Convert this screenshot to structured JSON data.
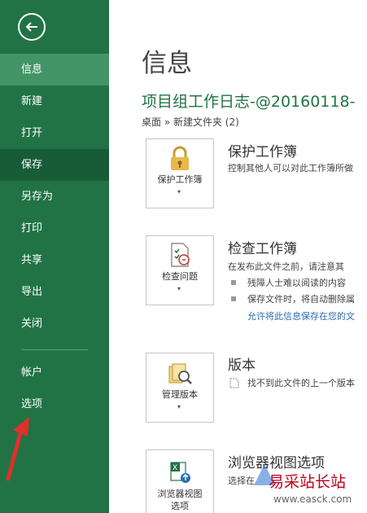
{
  "sidebar": {
    "items": [
      {
        "label": "信息"
      },
      {
        "label": "新建"
      },
      {
        "label": "打开"
      },
      {
        "label": "保存"
      },
      {
        "label": "另存为"
      },
      {
        "label": "打印"
      },
      {
        "label": "共享"
      },
      {
        "label": "导出"
      },
      {
        "label": "关闭"
      },
      {
        "label": "帐户"
      },
      {
        "label": "选项"
      }
    ]
  },
  "main": {
    "title": "信息",
    "file_name": "项目组工作日志-@20160118-",
    "breadcrumb": "桌面 » 新建文件夹 (2)",
    "sections": {
      "protect": {
        "button_label": "保护工作簿",
        "title": "保护工作簿",
        "desc": "控制其他人可以对此工作簿所做"
      },
      "inspect": {
        "button_label": "检查问题",
        "title": "检查工作簿",
        "desc": "在发布此文件之前，请注意其",
        "bullet1": "残障人士难以阅读的内容",
        "bullet2": "保存文件时，将自动删除属",
        "link": "允许将此信息保存在您的文"
      },
      "versions": {
        "button_label": "管理版本",
        "title": "版本",
        "desc": "找不到此文件的上一个版本"
      },
      "browser": {
        "button_label_line1": "浏览器视图",
        "button_label_line2": "选项",
        "title": "浏览器视图选项",
        "desc": "选择在"
      }
    }
  },
  "watermark": {
    "text": "易采站长站",
    "url": "www.easck.com"
  },
  "colors": {
    "sidebar": "#217346",
    "active": "#439467",
    "accent": "#217346",
    "arrow": "#e0302a"
  }
}
